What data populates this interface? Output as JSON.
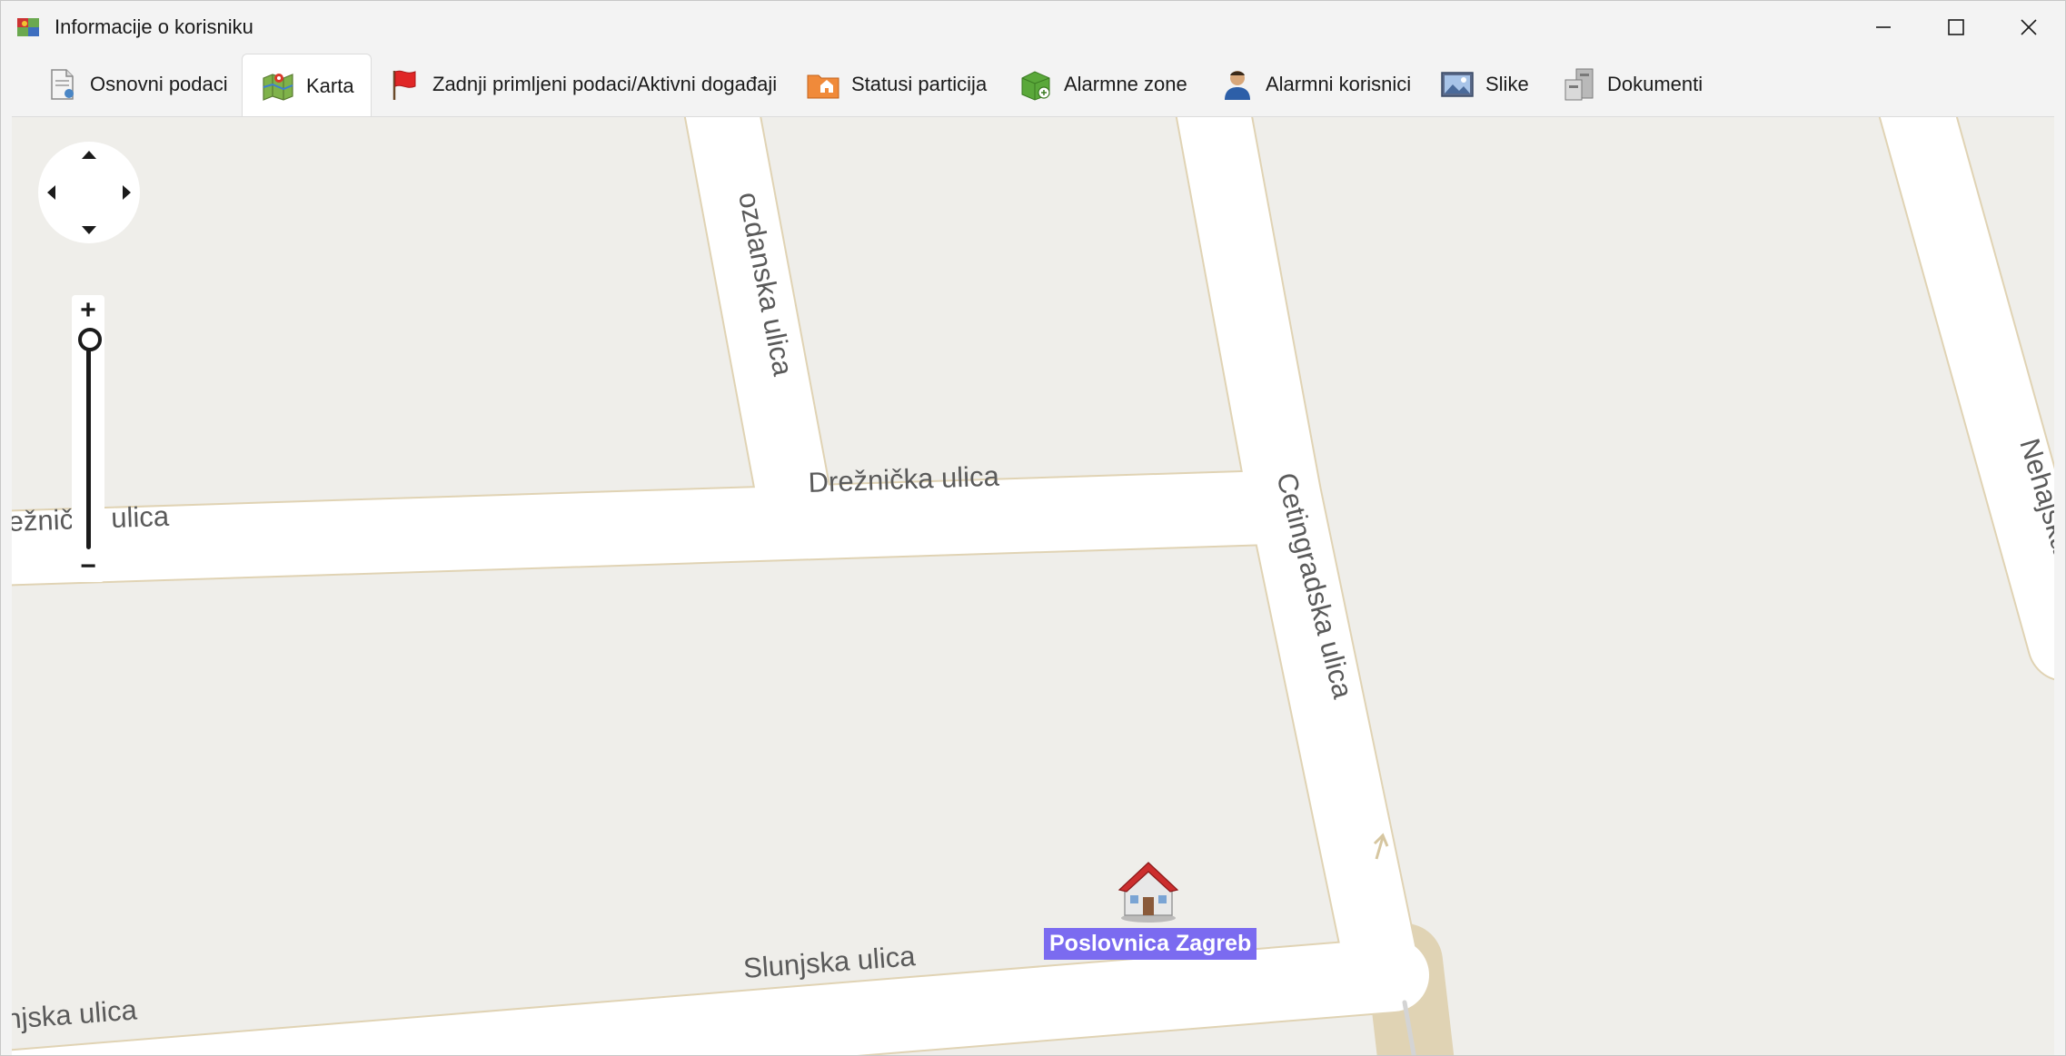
{
  "window": {
    "title": "Informacije o korisniku",
    "controls": [
      "minimize",
      "maximize",
      "close"
    ]
  },
  "tabs": [
    {
      "label": "Osnovni podaci",
      "icon": "document-icon",
      "active": false
    },
    {
      "label": "Karta",
      "icon": "map-icon",
      "active": true
    },
    {
      "label": "Zadnji primljeni podaci/Aktivni događaji",
      "icon": "flag-icon",
      "active": false
    },
    {
      "label": "Statusi particija",
      "icon": "folder-home-icon",
      "active": false
    },
    {
      "label": "Alarmne zone",
      "icon": "zone-icon",
      "active": false
    },
    {
      "label": "Alarmni korisnici",
      "icon": "user-icon",
      "active": false
    },
    {
      "label": "Slike",
      "icon": "image-icon",
      "active": false
    },
    {
      "label": "Dokumenti",
      "icon": "documents-icon",
      "active": false
    }
  ],
  "map": {
    "streets": {
      "s1": "ozdanska ulica",
      "s2": "Drežnička ulica",
      "s3": "ežnička ulica",
      "s4": "Cetingradska ulica",
      "s5": "Nehajska ulica",
      "s6": "Slunjska ulica",
      "s7": "njska ulica"
    },
    "marker": {
      "label": "Poslovnica Zagreb",
      "icon": "house-icon"
    },
    "zoom_controls": {
      "plus": "+",
      "minus": "−"
    },
    "zoom_level": 0.95,
    "colors": {
      "background": "#efeeea",
      "road": "#ffffff",
      "road_edge": "#e0d3b4",
      "marker_label": "#7b6bf0"
    }
  }
}
